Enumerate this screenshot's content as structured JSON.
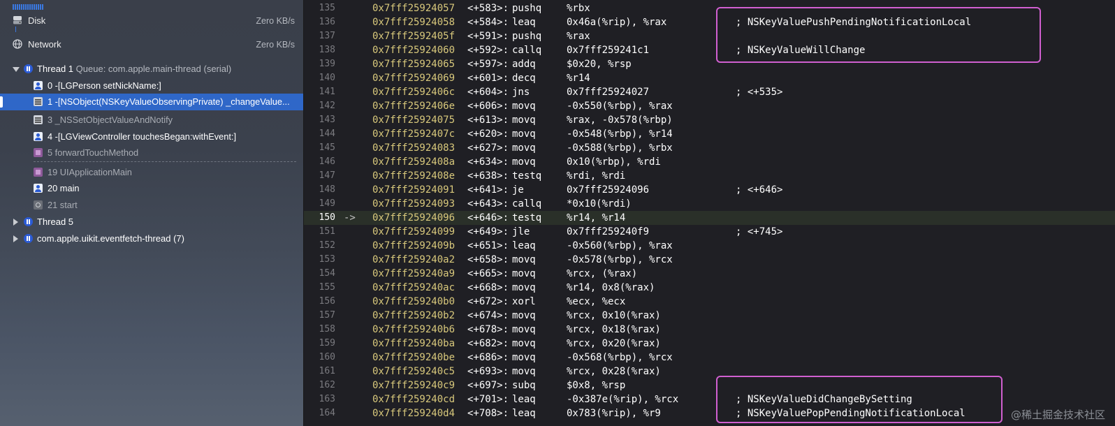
{
  "gauges": [
    {
      "label": "Disk",
      "value": "Zero KB/s",
      "icon": "disk-icon"
    },
    {
      "label": "Network",
      "value": "Zero KB/s",
      "icon": "network-icon"
    }
  ],
  "threads": {
    "main": {
      "title": "Thread 1",
      "queue": "Queue: com.apple.main-thread (serial)"
    },
    "frames": [
      {
        "label": "0 -[LGPerson setNickName:]",
        "icon": "user-frame-icon",
        "style": "bright"
      },
      {
        "label": "1 -[NSObject(NSKeyValueObservingPrivate) _changeValue...",
        "icon": "system-frame-icon",
        "style": "bright",
        "selected": true
      },
      {
        "label": "3 _NSSetObjectValueAndNotify",
        "icon": "system-frame-icon",
        "style": "dim"
      },
      {
        "label": "4 -[LGViewController touchesBegan:withEvent:]",
        "icon": "user-frame-icon",
        "style": "bright"
      },
      {
        "label": "5 forwardTouchMethod",
        "icon": "uikit-frame-icon",
        "style": "dim"
      },
      {
        "label": "19 UIApplicationMain",
        "icon": "uikit-frame-icon",
        "style": "dim"
      },
      {
        "label": "20 main",
        "icon": "user-frame-icon",
        "style": "bright"
      },
      {
        "label": "21 start",
        "icon": "dyld-frame-icon",
        "style": "dim"
      }
    ],
    "others": [
      {
        "title": "Thread 5"
      },
      {
        "title": "com.apple.uikit.eventfetch-thread (7)"
      }
    ]
  },
  "disassembly": [
    {
      "ln": "135",
      "addr": "0x7fff25924057",
      "off": "<+583>:",
      "ins": "pushq",
      "ops": "%rbx",
      "cmt": ""
    },
    {
      "ln": "136",
      "addr": "0x7fff25924058",
      "off": "<+584>:",
      "ins": "leaq",
      "ops": "0x46a(%rip), %rax",
      "cmt": "; NSKeyValuePushPendingNotificationLocal"
    },
    {
      "ln": "137",
      "addr": "0x7fff2592405f",
      "off": "<+591>:",
      "ins": "pushq",
      "ops": "%rax",
      "cmt": ""
    },
    {
      "ln": "138",
      "addr": "0x7fff25924060",
      "off": "<+592>:",
      "ins": "callq",
      "ops": "0x7fff259241c1",
      "cmt": "; NSKeyValueWillChange"
    },
    {
      "ln": "139",
      "addr": "0x7fff25924065",
      "off": "<+597>:",
      "ins": "addq",
      "ops": "$0x20, %rsp",
      "cmt": ""
    },
    {
      "ln": "140",
      "addr": "0x7fff25924069",
      "off": "<+601>:",
      "ins": "decq",
      "ops": "%r14",
      "cmt": ""
    },
    {
      "ln": "141",
      "addr": "0x7fff2592406c",
      "off": "<+604>:",
      "ins": "jns",
      "ops": "0x7fff25924027",
      "cmt": "; <+535>"
    },
    {
      "ln": "142",
      "addr": "0x7fff2592406e",
      "off": "<+606>:",
      "ins": "movq",
      "ops": "-0x550(%rbp), %rax",
      "cmt": ""
    },
    {
      "ln": "143",
      "addr": "0x7fff25924075",
      "off": "<+613>:",
      "ins": "movq",
      "ops": "%rax, -0x578(%rbp)",
      "cmt": ""
    },
    {
      "ln": "144",
      "addr": "0x7fff2592407c",
      "off": "<+620>:",
      "ins": "movq",
      "ops": "-0x548(%rbp), %r14",
      "cmt": ""
    },
    {
      "ln": "145",
      "addr": "0x7fff25924083",
      "off": "<+627>:",
      "ins": "movq",
      "ops": "-0x588(%rbp), %rbx",
      "cmt": ""
    },
    {
      "ln": "146",
      "addr": "0x7fff2592408a",
      "off": "<+634>:",
      "ins": "movq",
      "ops": "0x10(%rbp), %rdi",
      "cmt": ""
    },
    {
      "ln": "147",
      "addr": "0x7fff2592408e",
      "off": "<+638>:",
      "ins": "testq",
      "ops": "%rdi, %rdi",
      "cmt": ""
    },
    {
      "ln": "148",
      "addr": "0x7fff25924091",
      "off": "<+641>:",
      "ins": "je",
      "ops": "0x7fff25924096",
      "cmt": "; <+646>"
    },
    {
      "ln": "149",
      "addr": "0x7fff25924093",
      "off": "<+643>:",
      "ins": "callq",
      "ops": "*0x10(%rdi)",
      "cmt": ""
    },
    {
      "ln": "150",
      "addr": "0x7fff25924096",
      "off": "<+646>:",
      "ins": "testq",
      "ops": "%r14, %r14",
      "cmt": "",
      "current": true,
      "arrow": "->"
    },
    {
      "ln": "151",
      "addr": "0x7fff25924099",
      "off": "<+649>:",
      "ins": "jle",
      "ops": "0x7fff259240f9",
      "cmt": "; <+745>"
    },
    {
      "ln": "152",
      "addr": "0x7fff2592409b",
      "off": "<+651>:",
      "ins": "leaq",
      "ops": "-0x560(%rbp), %rax",
      "cmt": ""
    },
    {
      "ln": "153",
      "addr": "0x7fff259240a2",
      "off": "<+658>:",
      "ins": "movq",
      "ops": "-0x578(%rbp), %rcx",
      "cmt": ""
    },
    {
      "ln": "154",
      "addr": "0x7fff259240a9",
      "off": "<+665>:",
      "ins": "movq",
      "ops": "%rcx, (%rax)",
      "cmt": ""
    },
    {
      "ln": "155",
      "addr": "0x7fff259240ac",
      "off": "<+668>:",
      "ins": "movq",
      "ops": "%r14, 0x8(%rax)",
      "cmt": ""
    },
    {
      "ln": "156",
      "addr": "0x7fff259240b0",
      "off": "<+672>:",
      "ins": "xorl",
      "ops": "%ecx, %ecx",
      "cmt": ""
    },
    {
      "ln": "157",
      "addr": "0x7fff259240b2",
      "off": "<+674>:",
      "ins": "movq",
      "ops": "%rcx, 0x10(%rax)",
      "cmt": ""
    },
    {
      "ln": "158",
      "addr": "0x7fff259240b6",
      "off": "<+678>:",
      "ins": "movq",
      "ops": "%rcx, 0x18(%rax)",
      "cmt": ""
    },
    {
      "ln": "159",
      "addr": "0x7fff259240ba",
      "off": "<+682>:",
      "ins": "movq",
      "ops": "%rcx, 0x20(%rax)",
      "cmt": ""
    },
    {
      "ln": "160",
      "addr": "0x7fff259240be",
      "off": "<+686>:",
      "ins": "movq",
      "ops": "-0x568(%rbp), %rcx",
      "cmt": ""
    },
    {
      "ln": "161",
      "addr": "0x7fff259240c5",
      "off": "<+693>:",
      "ins": "movq",
      "ops": "%rcx, 0x28(%rax)",
      "cmt": ""
    },
    {
      "ln": "162",
      "addr": "0x7fff259240c9",
      "off": "<+697>:",
      "ins": "subq",
      "ops": "$0x8, %rsp",
      "cmt": ""
    },
    {
      "ln": "163",
      "addr": "0x7fff259240cd",
      "off": "<+701>:",
      "ins": "leaq",
      "ops": "-0x387e(%rip), %rcx",
      "cmt": "; NSKeyValueDidChangeBySetting"
    },
    {
      "ln": "164",
      "addr": "0x7fff259240d4",
      "off": "<+708>:",
      "ins": "leaq",
      "ops": "0x783(%rip), %r9",
      "cmt": "; NSKeyValuePopPendingNotificationLocal"
    }
  ],
  "watermark": "@稀土掘金技术社区",
  "colors": {
    "address": "#d9c97c",
    "highlight_box": "#d05fd0",
    "selection": "#2f67c8"
  }
}
